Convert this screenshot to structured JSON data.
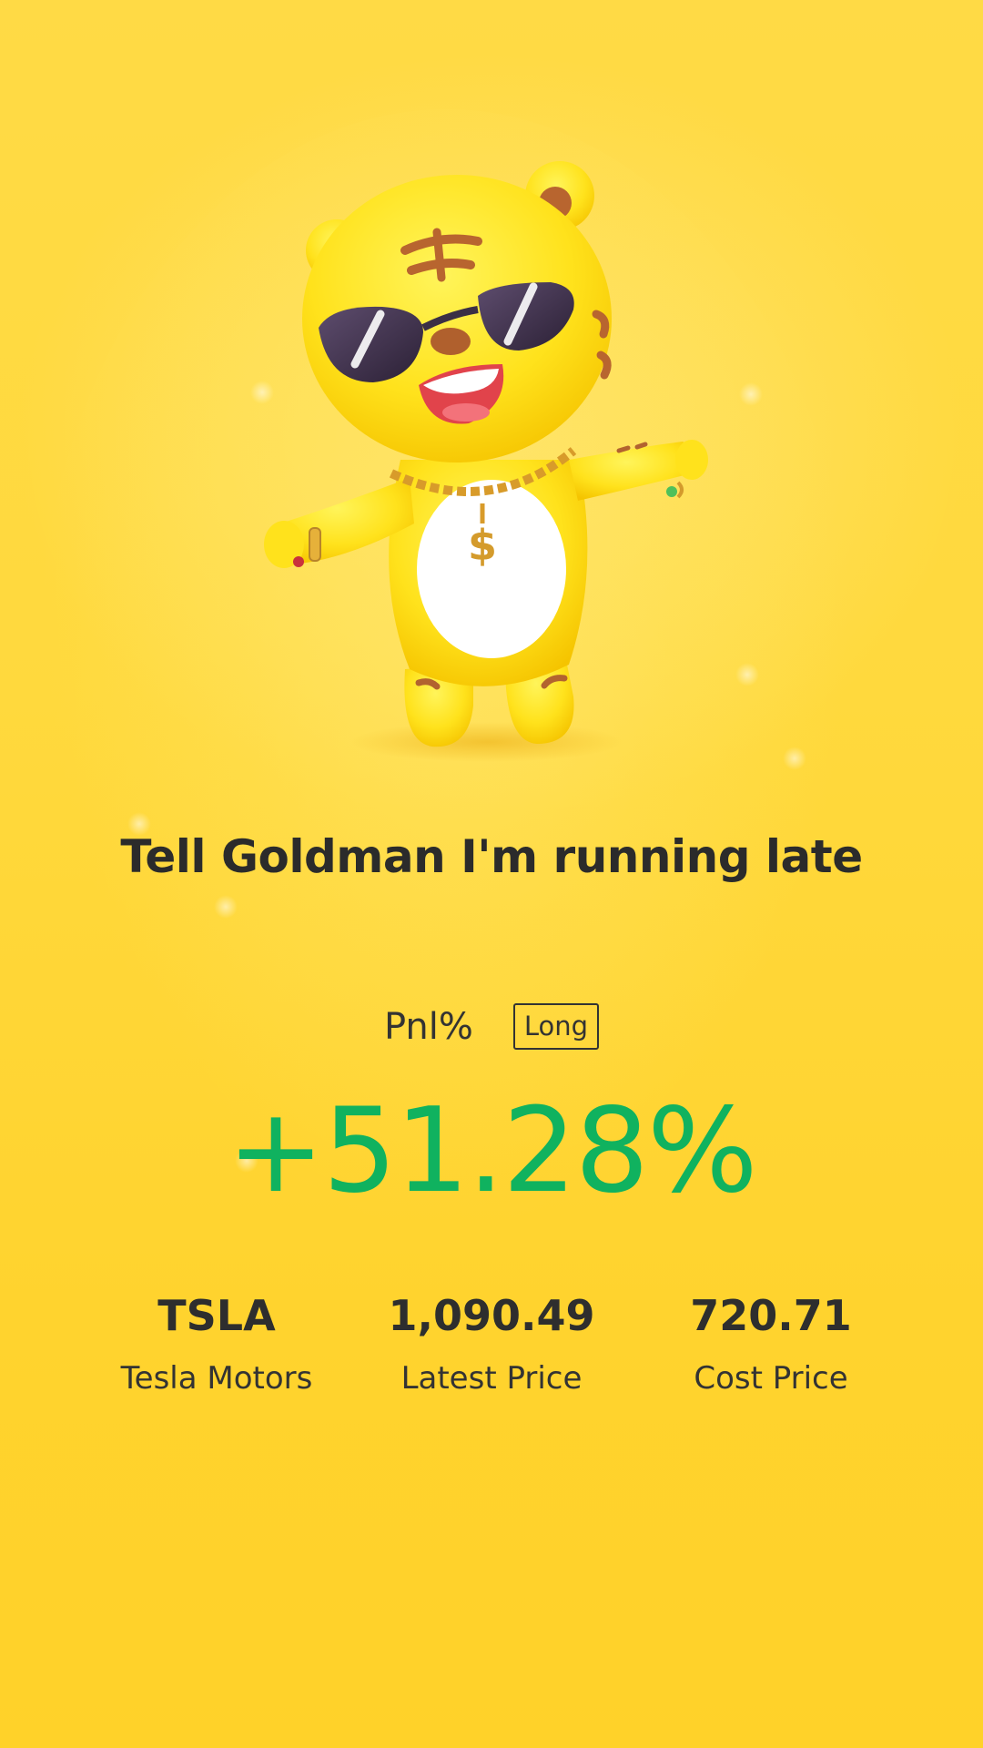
{
  "card": {
    "mascot_icon": "tiger-mascot-sunglasses-icon",
    "headline": "Tell Goldman I'm running late",
    "pnl_label": "Pnl%",
    "position_badge": "Long",
    "pnl_value": "+51.28%",
    "pnl_color": "#10b25f"
  },
  "stats": [
    {
      "value": "TSLA",
      "label": "Tesla Motors"
    },
    {
      "value": "1,090.49",
      "label": "Latest Price"
    },
    {
      "value": "720.71",
      "label": "Cost Price"
    }
  ],
  "colors": {
    "background": "#ffd93d",
    "text": "#2b2b2b",
    "positive": "#10b25f"
  }
}
